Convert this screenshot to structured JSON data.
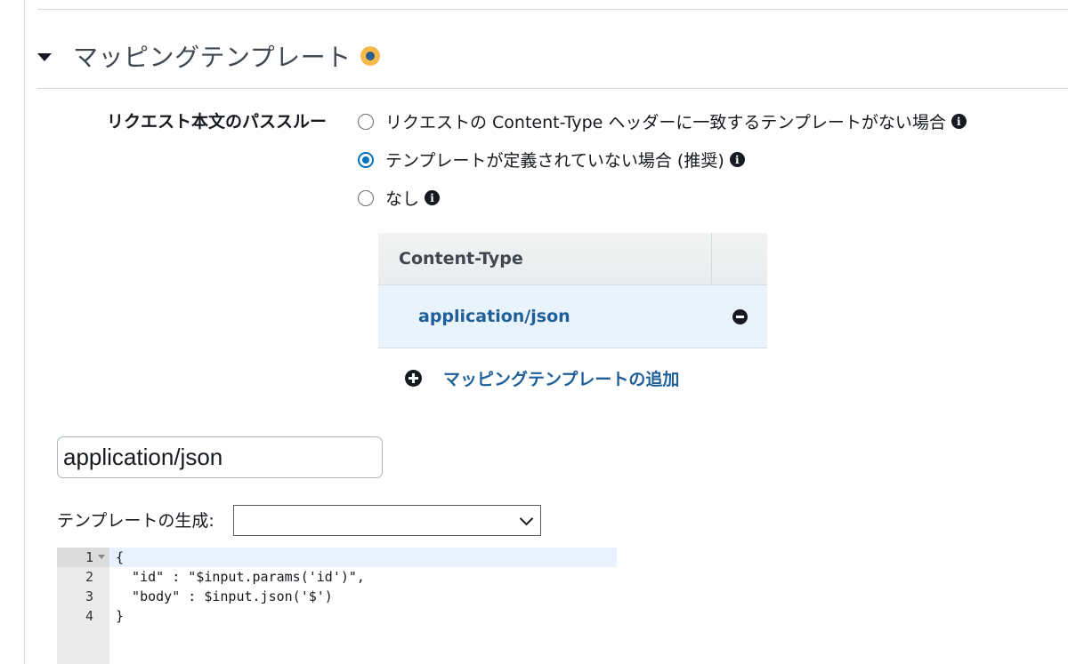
{
  "section": {
    "title": "マッピングテンプレート",
    "status_color": "#f8b94b"
  },
  "passthrough": {
    "label": "リクエスト本文のパススルー",
    "options": [
      {
        "label": "リクエストの Content-Type ヘッダーに一致するテンプレートがない場合",
        "checked": false
      },
      {
        "label": "テンプレートが定義されていない場合 (推奨)",
        "checked": true
      },
      {
        "label": "なし",
        "checked": false
      }
    ]
  },
  "table": {
    "header": "Content-Type",
    "rows": [
      "application/json"
    ]
  },
  "add_link": "マッピングテンプレートの追加",
  "content_type_input": {
    "value": "application/json"
  },
  "generate": {
    "label": "テンプレートの生成:",
    "selected": ""
  },
  "editor": {
    "lines": [
      {
        "num": "1",
        "code": "{"
      },
      {
        "num": "2",
        "code": "  \"id\" : \"$input.params('id')\","
      },
      {
        "num": "3",
        "code": "  \"body\" : $input.json('$')"
      },
      {
        "num": "4",
        "code": "}"
      }
    ]
  },
  "icons": {
    "collapse": "caret-down-icon",
    "info": "info-icon",
    "remove": "minus-circle-icon",
    "add": "plus-circle-icon",
    "dropdown": "chevron-down-icon"
  },
  "colors": {
    "link": "#1f5f99",
    "radio_checked": "#0073bb",
    "row_selected": "#e9f3fb"
  }
}
